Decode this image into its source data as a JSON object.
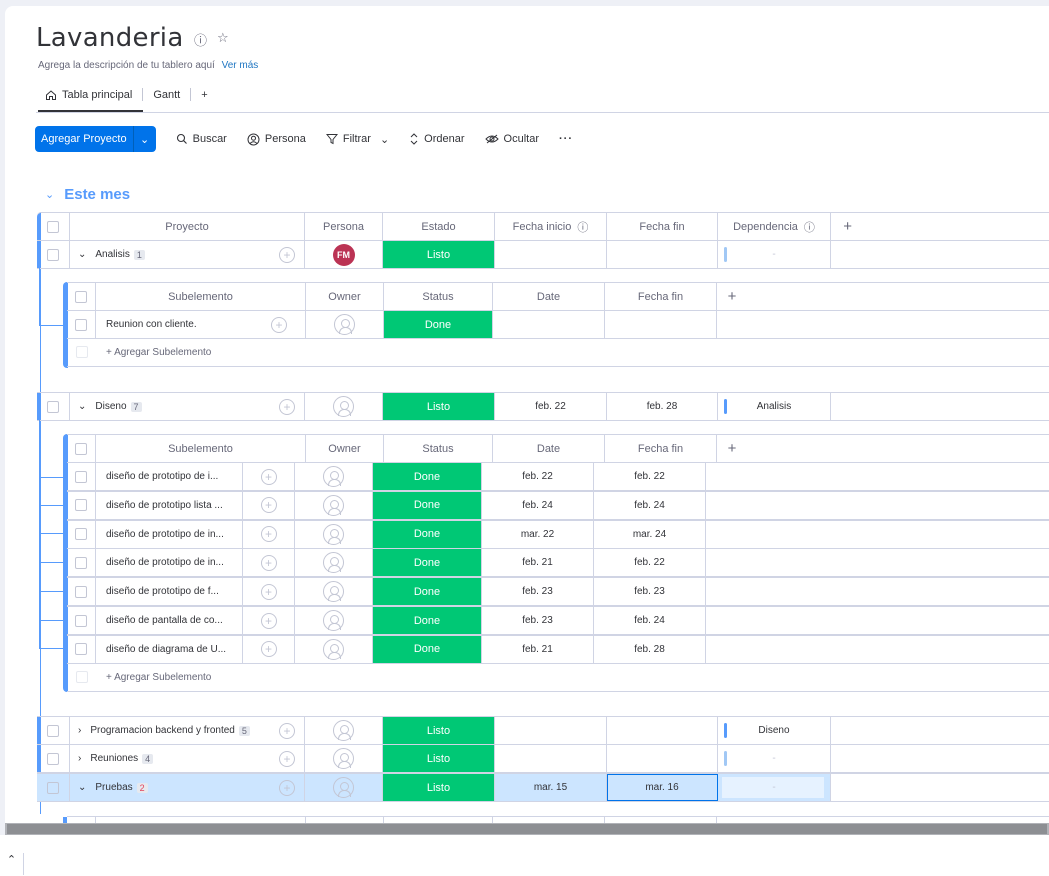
{
  "board": {
    "title": "Lavanderia",
    "description": "Agrega la descripción de tu tablero aquí",
    "see_more": "Ver más",
    "views": [
      "Tabla principal",
      "Gantt"
    ],
    "add_view": "+"
  },
  "toolbar": {
    "add_project": "Agregar Proyecto",
    "search": "Buscar",
    "person": "Persona",
    "filter": "Filtrar",
    "sort": "Ordenar",
    "hide": "Ocultar",
    "more": "···"
  },
  "group": {
    "title": "Este mes",
    "columns": [
      "Proyecto",
      "Persona",
      "Estado",
      "Fecha inicio",
      "Fecha fin",
      "Dependencia"
    ],
    "color": "#579bfc"
  },
  "sub_columns": [
    "Subelemento",
    "Owner",
    "Status",
    "Date",
    "Fecha fin"
  ],
  "add_subitem": "+ Agregar Subelemento",
  "items": [
    {
      "name": "Analisis",
      "count": "1",
      "person": "FM",
      "status": "Listo",
      "start": "",
      "end": "",
      "dep": "-"
    },
    {
      "name": "Diseno",
      "count": "7",
      "person": "",
      "status": "Listo",
      "start": "feb. 22",
      "end": "feb. 28",
      "dep": "Analisis"
    },
    {
      "name": "Programacion backend y fronted",
      "count": "5",
      "person": "",
      "status": "Listo",
      "start": "",
      "end": "",
      "dep": "Diseno"
    },
    {
      "name": "Reuniones",
      "count": "4",
      "person": "",
      "status": "Listo",
      "start": "",
      "end": "",
      "dep": "-"
    },
    {
      "name": "Pruebas",
      "count": "2",
      "person": "",
      "status": "Listo",
      "start": "mar. 15",
      "end": "mar. 16",
      "dep": "-"
    }
  ],
  "subitems_analisis": [
    {
      "name": "Reunion con cliente.",
      "status": "Done",
      "date": "",
      "end": ""
    }
  ],
  "subitems_diseno": [
    {
      "name": "diseño de prototipo de i...",
      "status": "Done",
      "date": "feb. 22",
      "end": "feb. 22"
    },
    {
      "name": "diseño de prototipo lista ...",
      "status": "Done",
      "date": "feb. 24",
      "end": "feb. 24"
    },
    {
      "name": "diseño de prototipo de in...",
      "status": "Done",
      "date": "mar. 22",
      "end": "mar. 24"
    },
    {
      "name": "diseño de prototipo de in...",
      "status": "Done",
      "date": "feb. 21",
      "end": "feb. 22"
    },
    {
      "name": "diseño de prototipo de f...",
      "status": "Done",
      "date": "feb. 23",
      "end": "feb. 23"
    },
    {
      "name": "diseño de pantalla de co...",
      "status": "Done",
      "date": "feb. 23",
      "end": "feb. 24"
    },
    {
      "name": "diseño de diagrama de U...",
      "status": "Done",
      "date": "feb. 21",
      "end": "feb. 28"
    }
  ],
  "colors": {
    "status_done": "#00c875",
    "accent": "#0073ea",
    "selected_row": "#cce5ff",
    "avatar_fm": "#bb3354"
  }
}
